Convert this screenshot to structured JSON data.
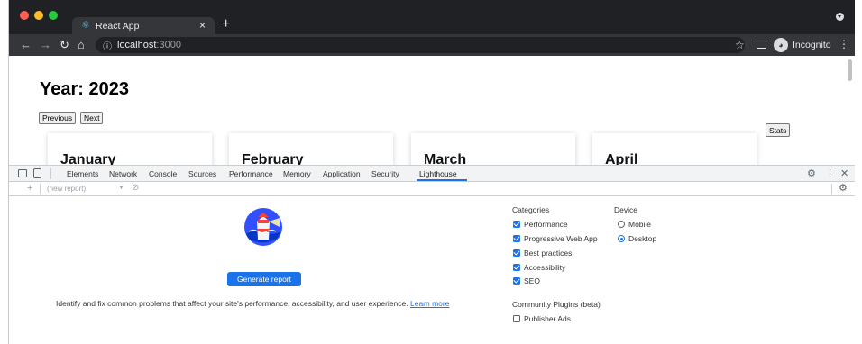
{
  "browser": {
    "tab_title": "React App",
    "tab_close": "×",
    "new_tab": "+",
    "url_host": "localhost",
    "url_port": ":3000",
    "profile_label": "Incognito"
  },
  "page": {
    "year_heading": "Year: 2023",
    "prev_label": "Previous",
    "next_label": "Next",
    "stats_label": "Stats",
    "months": [
      "January",
      "February",
      "March",
      "April"
    ]
  },
  "devtools": {
    "tabs": [
      "Elements",
      "Network",
      "Console",
      "Sources",
      "Performance",
      "Memory",
      "Application",
      "Security",
      "Lighthouse"
    ],
    "active_tab": "Lighthouse",
    "report_select": "(new report)"
  },
  "lighthouse": {
    "generate_label": "Generate report",
    "description": "Identify and fix common problems that affect your site's performance, accessibility, and user experience.",
    "learn_more": "Learn more",
    "categories_heading": "Categories",
    "categories": [
      {
        "label": "Performance",
        "checked": true
      },
      {
        "label": "Progressive Web App",
        "checked": true
      },
      {
        "label": "Best practices",
        "checked": true
      },
      {
        "label": "Accessibility",
        "checked": true
      },
      {
        "label": "SEO",
        "checked": true
      }
    ],
    "device_heading": "Device",
    "devices": [
      {
        "label": "Mobile",
        "selected": false
      },
      {
        "label": "Desktop",
        "selected": true
      }
    ],
    "plugins_heading": "Community Plugins (beta)",
    "plugins": [
      {
        "label": "Publisher Ads",
        "checked": false
      }
    ]
  },
  "colors": {
    "accent": "#1a73e8",
    "chrome_dark": "#202124",
    "toolbar": "#35363a"
  }
}
